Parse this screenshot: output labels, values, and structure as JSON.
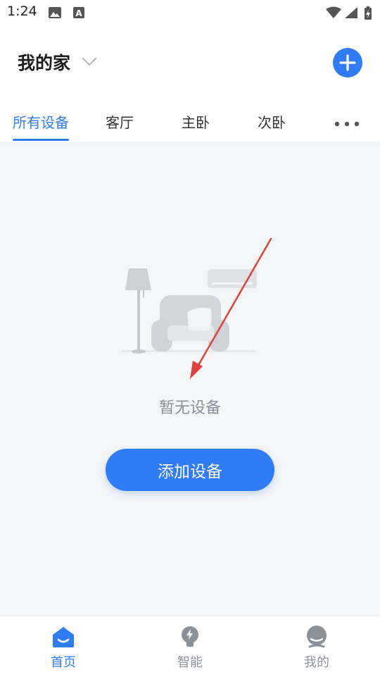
{
  "status_bar": {
    "time": "1:24",
    "icons": [
      "image-icon",
      "a-badge-icon",
      "wifi-icon",
      "signal-icon",
      "battery-charging-icon"
    ]
  },
  "header": {
    "home_name": "我的家",
    "dropdown_icon": "chevron-down-icon",
    "add_icon": "plus-icon"
  },
  "tabs": {
    "items": [
      {
        "label": "所有设备",
        "active": true
      },
      {
        "label": "客厅",
        "active": false
      },
      {
        "label": "主卧",
        "active": false
      },
      {
        "label": "次卧",
        "active": false
      }
    ],
    "more_icon": "more-dots-icon"
  },
  "empty_state": {
    "illustration": "living-room-illustration",
    "message": "暂无设备",
    "button_label": "添加设备"
  },
  "bottom_nav": {
    "items": [
      {
        "label": "首页",
        "icon": "home-icon",
        "active": true
      },
      {
        "label": "智能",
        "icon": "smart-bulb-icon",
        "active": false
      },
      {
        "label": "我的",
        "icon": "profile-icon",
        "active": false
      }
    ]
  },
  "colors": {
    "accent": "#2f7cf6",
    "annotation_arrow": "#e0413c",
    "content_bg": "#f5f6f8"
  }
}
